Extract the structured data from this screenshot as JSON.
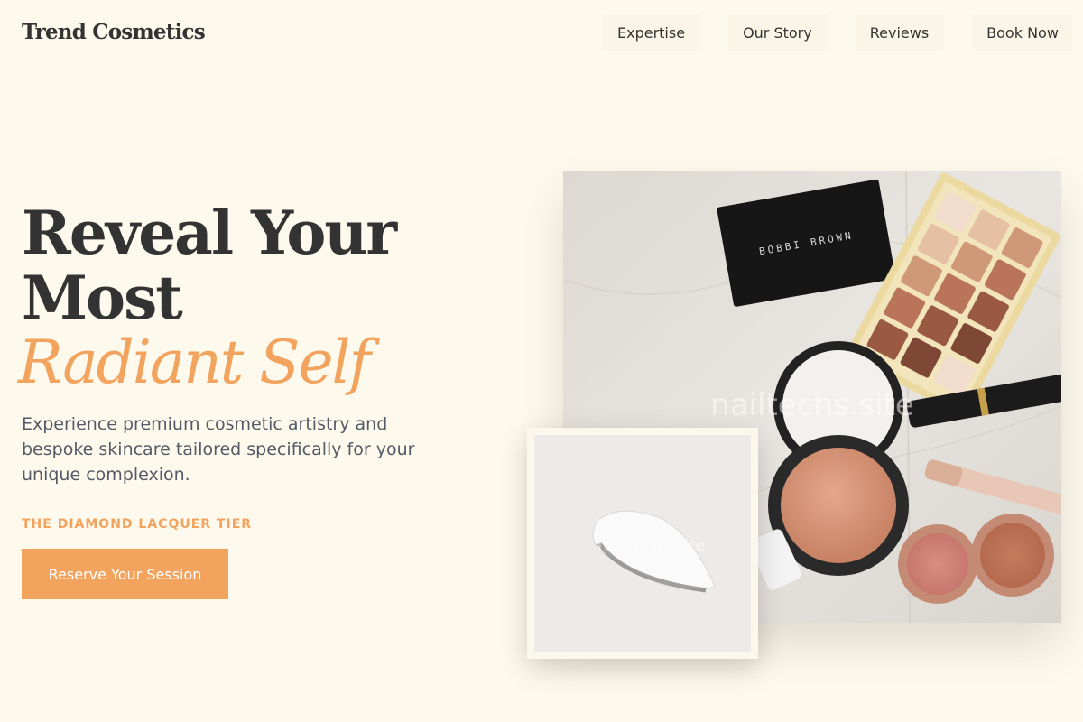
{
  "header": {
    "brand": "Trend Cosmetics",
    "nav": [
      {
        "label": "Expertise"
      },
      {
        "label": "Our Story"
      },
      {
        "label": "Reviews"
      },
      {
        "label": "Book Now"
      }
    ]
  },
  "hero": {
    "headline_line1": "Reveal Your",
    "headline_line2": "Most",
    "headline_accent": "Radiant Self",
    "description": "Experience premium cosmetic artistry and bespoke skincare tailored specifically for your unique complexion.",
    "tier_label": "THE DIAMOND LACQUER TIER",
    "cta_label": "Reserve Your Session"
  },
  "images": {
    "main_photo": {
      "palette_brand": "BOBBI BROWN",
      "watermark": "nailtechs.site"
    },
    "cream_photo": {
      "watermark": "nailtechs.site"
    }
  },
  "colors": {
    "background": "#fdf9ec",
    "accent": "#f2a35e",
    "text": "#333333",
    "muted_text": "#545a66"
  }
}
